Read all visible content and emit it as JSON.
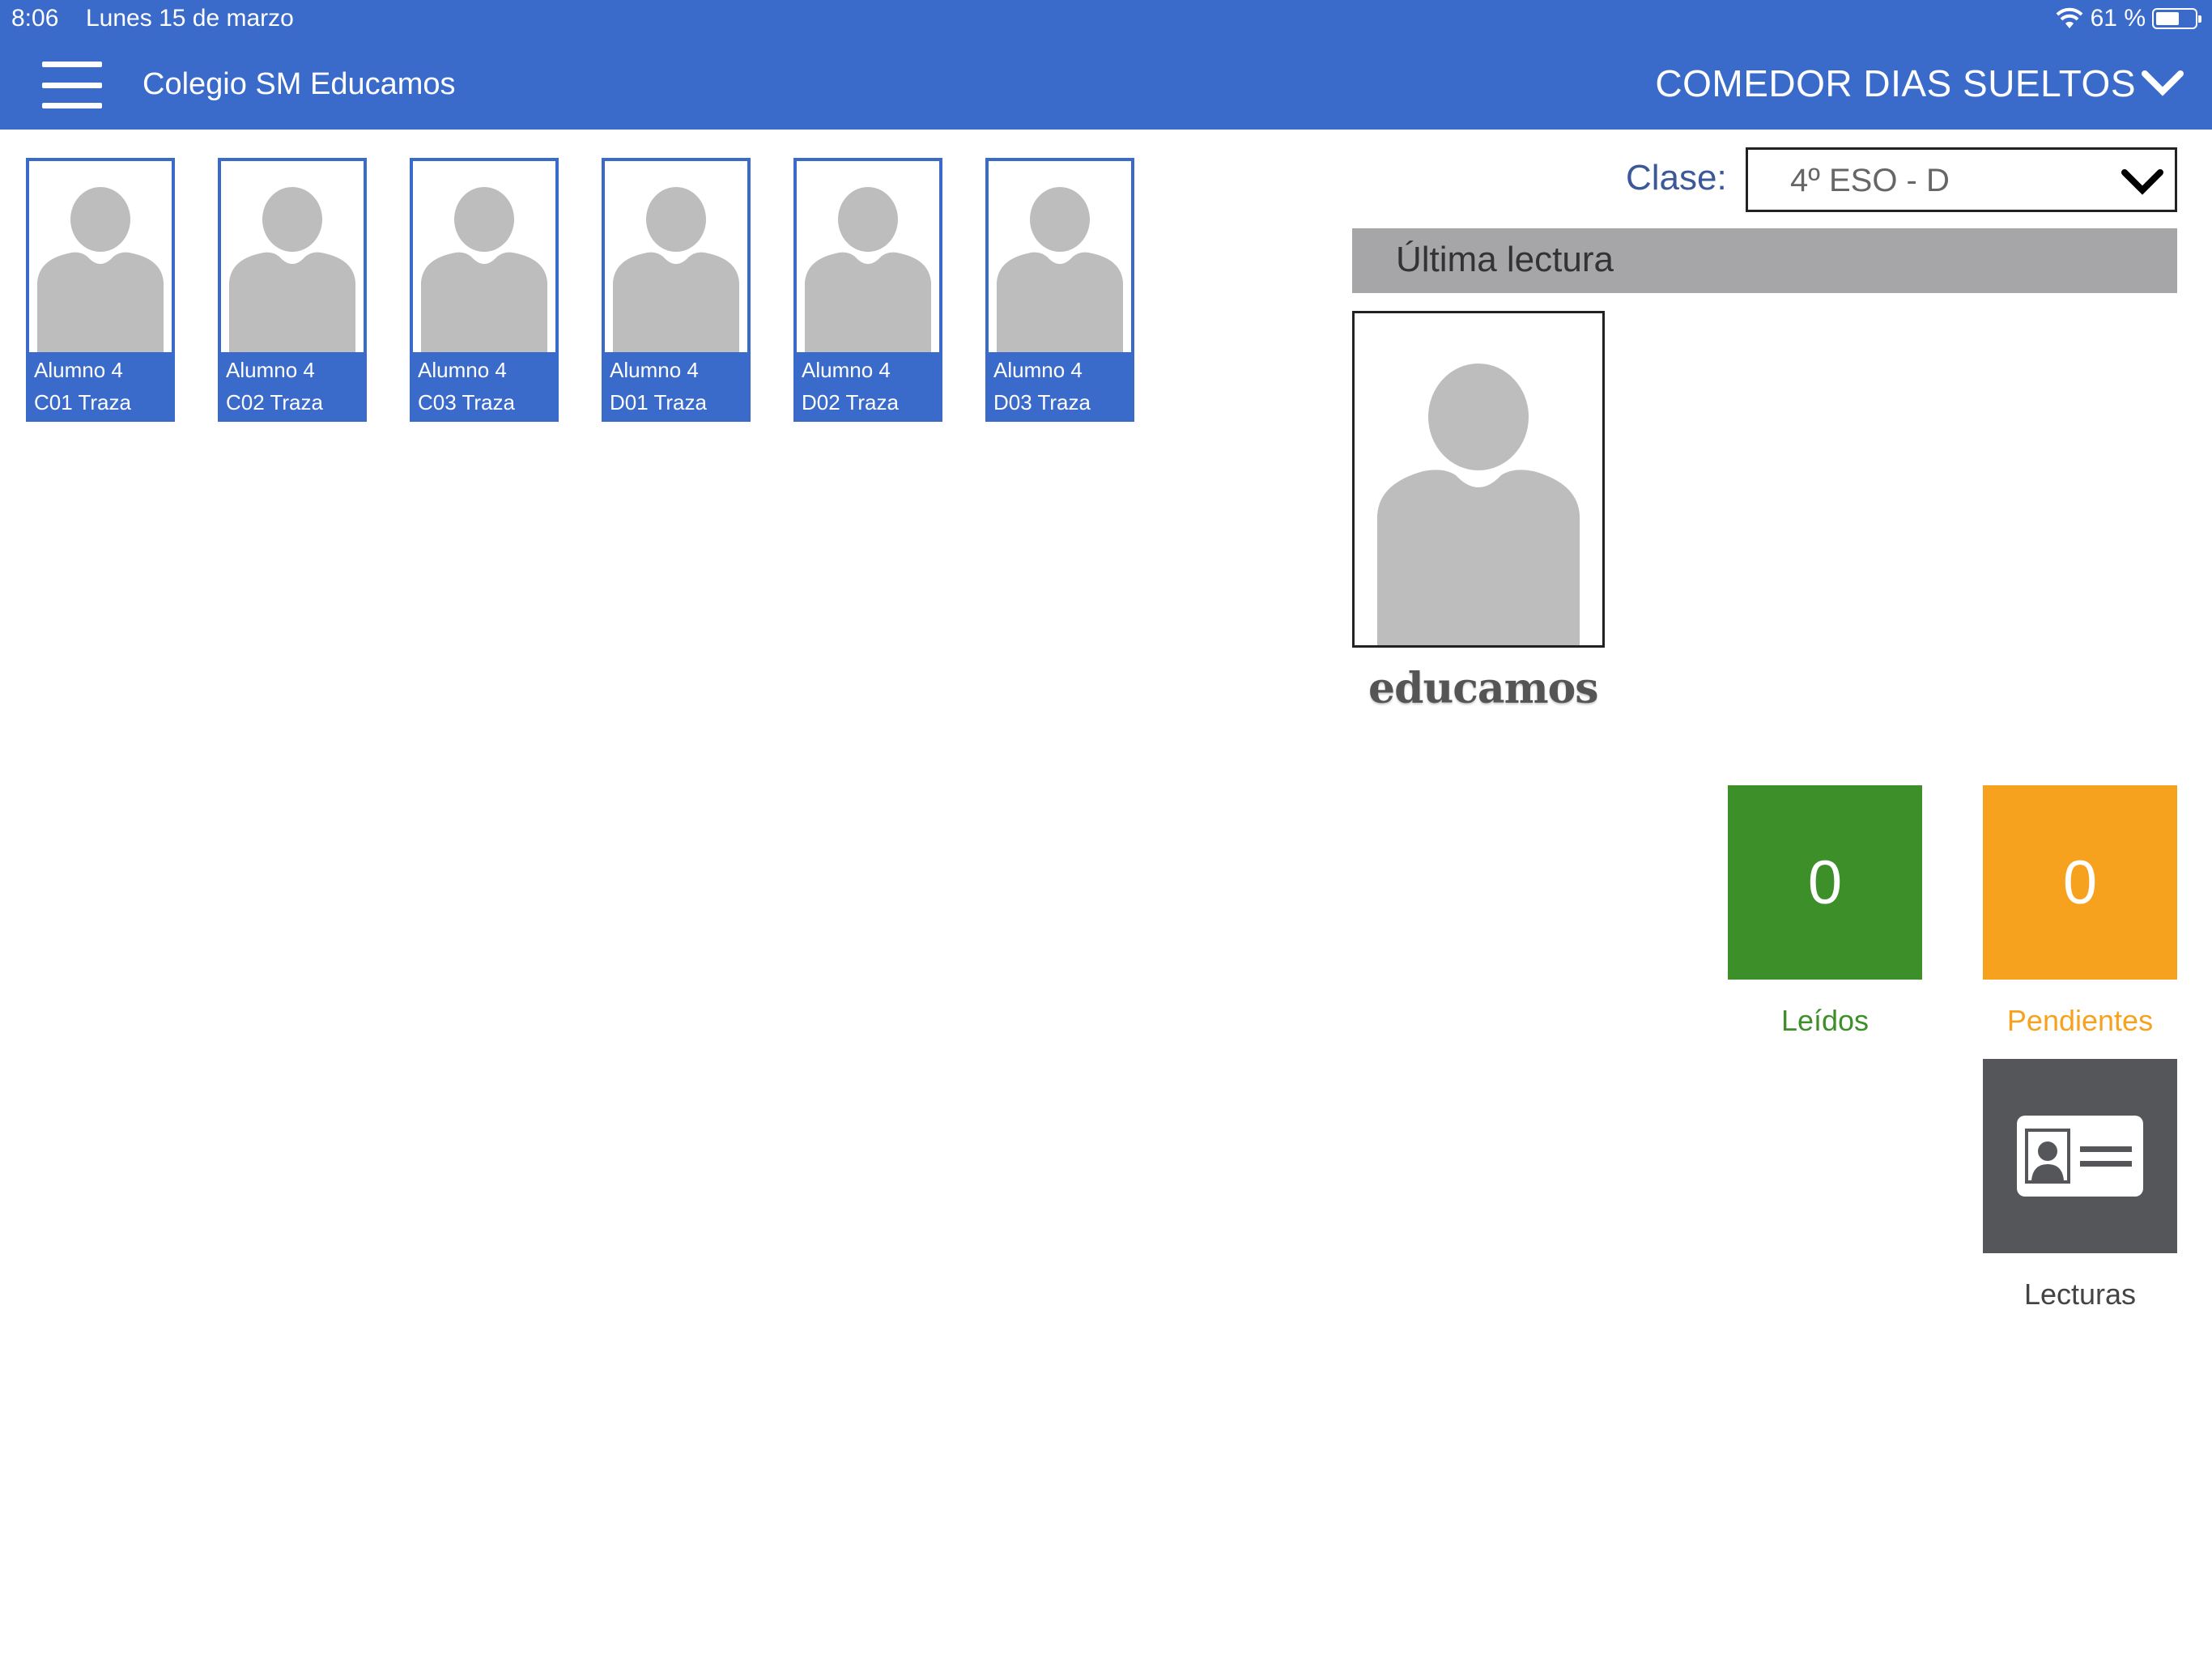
{
  "status_bar": {
    "time": "8:06",
    "date": "Lunes 15 de marzo",
    "battery": "61 %",
    "battery_level": 0.61,
    "icons": [
      "wifi-icon",
      "battery-icon"
    ]
  },
  "header": {
    "menu_icon": "hamburger-icon",
    "school_name": "Colegio SM Educamos",
    "section": "COMEDOR DIAS SUELTOS",
    "section_icon": "chevron-down-icon",
    "color": "#3b6bca"
  },
  "students": [
    {
      "name": "Alumno 4",
      "surname": "C01 Traza"
    },
    {
      "name": "Alumno 4",
      "surname": "C02 Traza"
    },
    {
      "name": "Alumno 4",
      "surname": "C03 Traza"
    },
    {
      "name": "Alumno 4",
      "surname": "D01 Traza"
    },
    {
      "name": "Alumno 4",
      "surname": "D02 Traza"
    },
    {
      "name": "Alumno 4",
      "surname": "D03 Traza"
    }
  ],
  "filter": {
    "label": "Clase:",
    "selected": "4º ESO - D"
  },
  "last_reading": {
    "title": "Última lectura",
    "logo": "educamos"
  },
  "counters": {
    "read": {
      "value": "0",
      "label": "Leídos",
      "color": "#3d8f2a"
    },
    "pending": {
      "value": "0",
      "label": "Pendientes",
      "color": "#f7a21e"
    },
    "readings": {
      "label": "Lecturas",
      "icon": "id-card-icon",
      "color": "#555659"
    }
  }
}
